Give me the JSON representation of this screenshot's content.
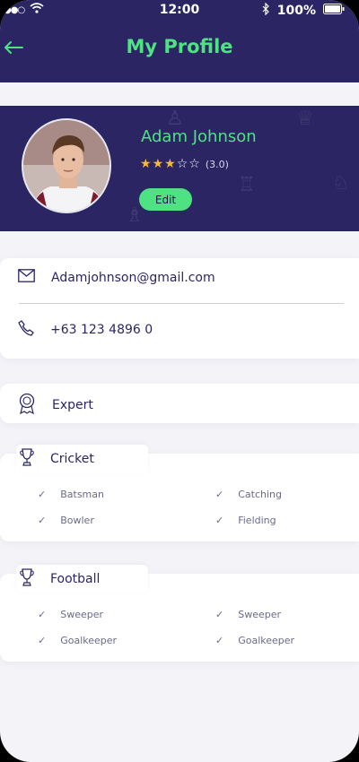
{
  "status_bar": {
    "time": "12:00",
    "battery": "100%"
  },
  "header": {
    "title": "My Profile"
  },
  "profile": {
    "name": "Adam Johnson",
    "rating": 3,
    "max_rating": 5,
    "rating_label": "(3.0)",
    "edit_label": "Edit"
  },
  "contact": {
    "email": "Adamjohnson@gmail.com",
    "phone": "+63 123 4896 0"
  },
  "level": {
    "label": "Expert"
  },
  "sports": [
    {
      "name": "Cricket",
      "skills": [
        "Batsman",
        "Catching",
        "Bowler",
        "Fielding"
      ]
    },
    {
      "name": "Football",
      "skills": [
        "Sweeper",
        "Sweeper",
        "Goalkeeper",
        "Goalkeeper"
      ]
    }
  ],
  "colors": {
    "primary": "#2b2663",
    "accent": "#4ee283",
    "star": "#f5b935",
    "background": "#f4f4f8"
  },
  "icons": {
    "back": "arrow-left-icon",
    "email": "envelope-icon",
    "phone": "phone-icon",
    "level": "award-badge-icon",
    "sport": "trophy-icon",
    "skill": "check-icon"
  }
}
